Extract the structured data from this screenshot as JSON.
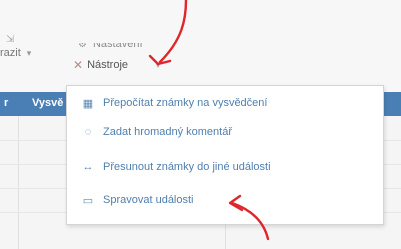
{
  "toolbar": {
    "zobrazit_label": "razit",
    "nastaveni_label": "Nastavení",
    "nastroje_label": "Nástroje"
  },
  "grid_header": {
    "col1_label": "Vysvě"
  },
  "tools_menu": {
    "items": [
      {
        "label": "Přepočítat známky na vysvědčení",
        "icon": "calculator-icon"
      },
      {
        "label": "Zadat hromadný komentář",
        "icon": "comment-icon"
      },
      {
        "label": "Přesunout známky do jiné události",
        "icon": "arrow-right-icon"
      },
      {
        "label": "Spravovat události",
        "icon": "calendar-icon"
      }
    ]
  },
  "colors": {
    "header_blue": "#4a7fb5",
    "menu_link": "#4f7fb0",
    "annotation_red": "#e0252b"
  }
}
